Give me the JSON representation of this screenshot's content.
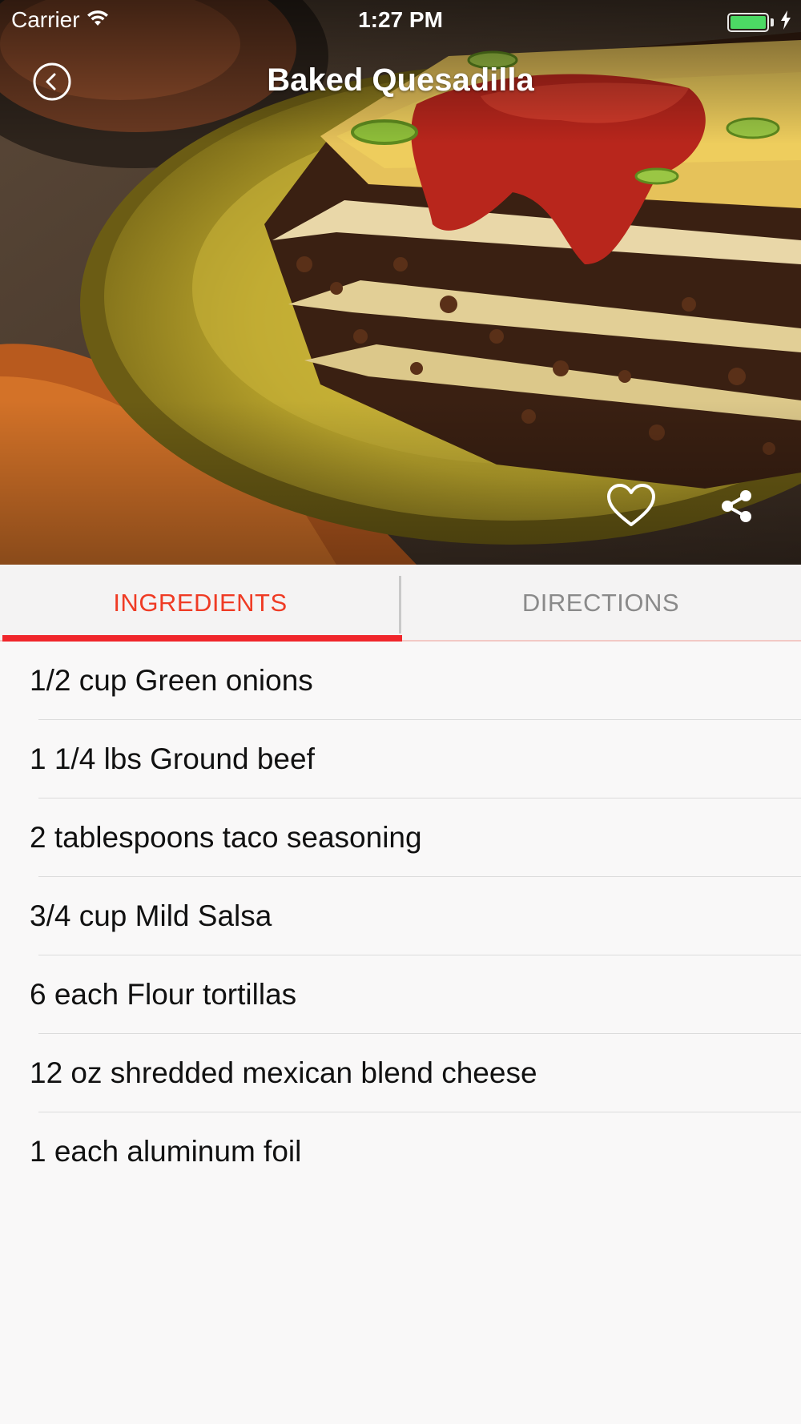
{
  "status_bar": {
    "carrier": "Carrier",
    "time": "1:27 PM",
    "battery_level": 1.0,
    "battery_color": "#4cd964",
    "wifi_icon": "wifi-icon",
    "charging_icon": "bolt-icon"
  },
  "nav": {
    "title": "Baked Quesadilla",
    "back_icon": "chevron-left-circle-icon"
  },
  "hero": {
    "favorite_icon": "heart-outline-icon",
    "share_icon": "share-icon"
  },
  "tabs": [
    {
      "label": "INGREDIENTS",
      "selected": true
    },
    {
      "label": "DIRECTIONS",
      "selected": false
    }
  ],
  "colors": {
    "accent": "#ef3b24",
    "underline": "#f0262b",
    "inactive_tab": "#8a8a8a"
  },
  "ingredients": [
    "1/2 cup Green onions",
    "1 1/4 lbs Ground beef",
    "2 tablespoons taco seasoning",
    "3/4 cup Mild Salsa",
    "6 each Flour tortillas",
    "12 oz shredded mexican blend cheese",
    "1 each aluminum foil"
  ]
}
